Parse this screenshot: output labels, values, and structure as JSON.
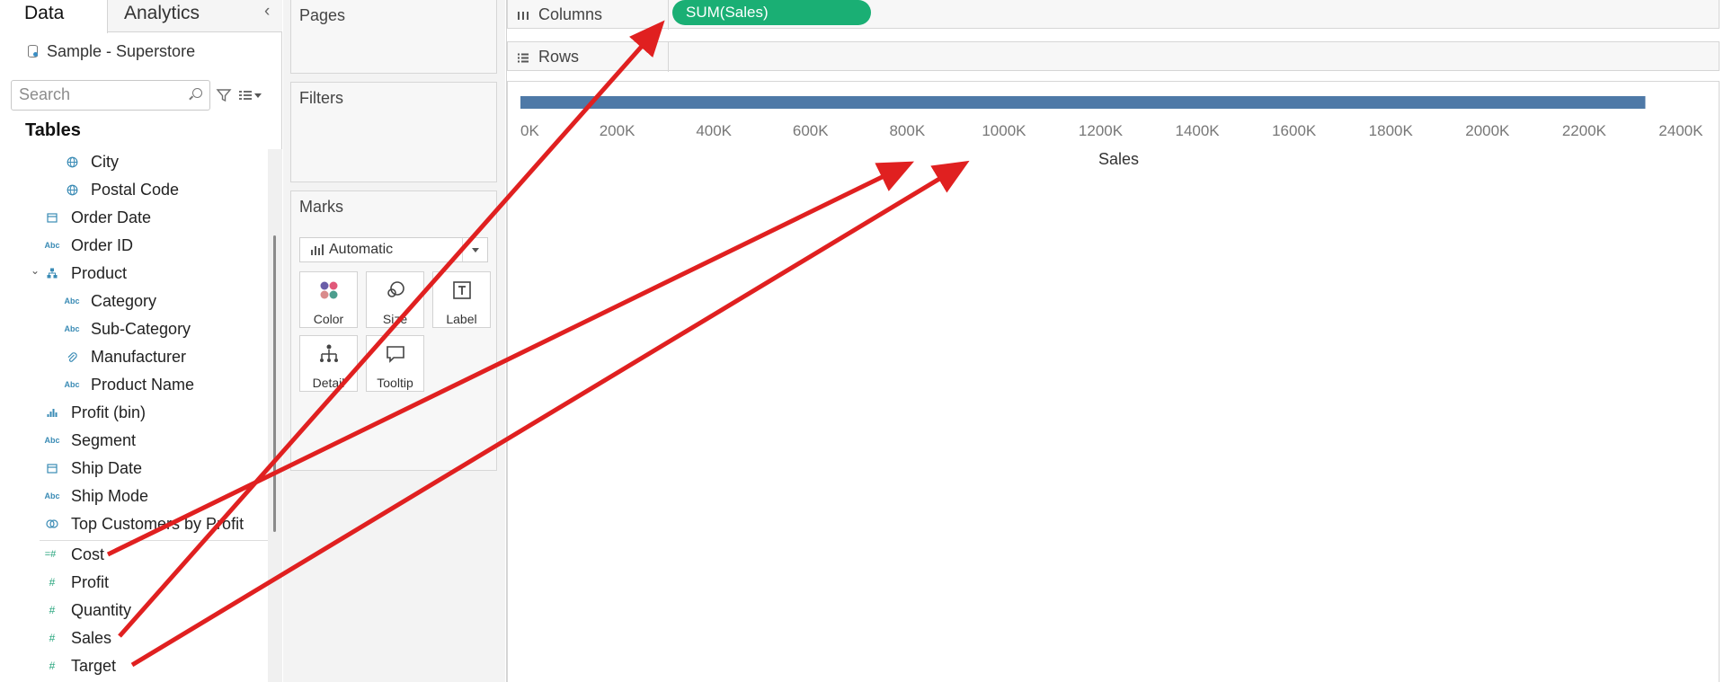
{
  "tabs": {
    "data": "Data",
    "analytics": "Analytics"
  },
  "datasource": {
    "name": "Sample - Superstore"
  },
  "search": {
    "placeholder": "Search"
  },
  "tables_heading": "Tables",
  "fields": [
    {
      "label": "City",
      "icon": "globe-icon"
    },
    {
      "label": "Postal Code",
      "icon": "globe-icon"
    },
    {
      "label": "Order Date",
      "icon": "calendar-icon"
    },
    {
      "label": "Order ID",
      "icon": "abc-icon"
    },
    {
      "label": "Product",
      "icon": "hierarchy-icon"
    },
    {
      "label": "Category",
      "icon": "abc-icon"
    },
    {
      "label": "Sub-Category",
      "icon": "abc-icon"
    },
    {
      "label": "Manufacturer",
      "icon": "paperclip-icon"
    },
    {
      "label": "Product Name",
      "icon": "abc-icon"
    },
    {
      "label": "Profit (bin)",
      "icon": "bin-icon"
    },
    {
      "label": "Segment",
      "icon": "abc-icon"
    },
    {
      "label": "Ship Date",
      "icon": "calendar-icon"
    },
    {
      "label": "Ship Mode",
      "icon": "abc-icon"
    },
    {
      "label": "Top Customers by Profit",
      "icon": "set-icon"
    },
    {
      "label": "Cost",
      "icon": "calculated-measure-icon"
    },
    {
      "label": "Profit",
      "icon": "hash-icon"
    },
    {
      "label": "Quantity",
      "icon": "hash-icon"
    },
    {
      "label": "Sales",
      "icon": "hash-icon"
    },
    {
      "label": "Target",
      "icon": "hash-icon"
    }
  ],
  "cards": {
    "pages": "Pages",
    "filters": "Filters",
    "marks": "Marks"
  },
  "marks": {
    "type": "Automatic",
    "buttons": {
      "color": "Color",
      "size": "Size",
      "label": "Label",
      "detail": "Detail",
      "tooltip": "Tooltip"
    }
  },
  "shelves": {
    "columns": "Columns",
    "rows": "Rows",
    "columns_pill": "SUM(Sales)"
  },
  "colors": {
    "bar": "#4e79a7",
    "pill": "#1aaf74",
    "arrow": "#e02020"
  },
  "chart_data": {
    "type": "bar",
    "orientation": "horizontal",
    "categories": [
      ""
    ],
    "series": [
      {
        "values": [
          2326534
        ]
      }
    ],
    "xlabel": "Sales",
    "xlim": [
      0,
      2400000
    ],
    "x_ticks": [
      "0K",
      "200K",
      "400K",
      "600K",
      "800K",
      "1000K",
      "1200K",
      "1400K",
      "1600K",
      "1800K",
      "2000K",
      "2200K",
      "2400K"
    ],
    "grid": false
  }
}
